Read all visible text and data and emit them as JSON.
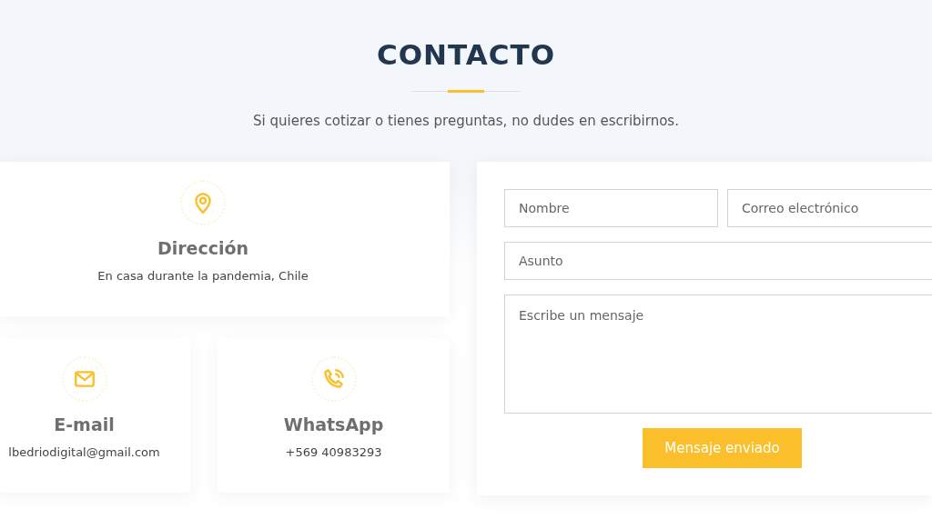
{
  "header": {
    "title": "CONTACTO",
    "subtitle": "Si quieres cotizar o tienes preguntas, no dudes en escribirnos."
  },
  "info_cards": [
    {
      "kind": "location",
      "title": "Dirección",
      "text": "En casa durante la pandemia, Chile"
    },
    {
      "kind": "email",
      "title": "E-mail",
      "text": "lbedriodigital@gmail.com"
    },
    {
      "kind": "phone",
      "title": "WhatsApp",
      "text": "+569 40983293"
    }
  ],
  "form": {
    "fields": [
      {
        "placeholder": "Nombre"
      },
      {
        "placeholder": "Correo electrónico"
      },
      {
        "placeholder": "Asunto"
      }
    ],
    "message": {
      "placeholder": "Escribe un mensaje"
    },
    "button": "Mensaje enviado"
  }
}
